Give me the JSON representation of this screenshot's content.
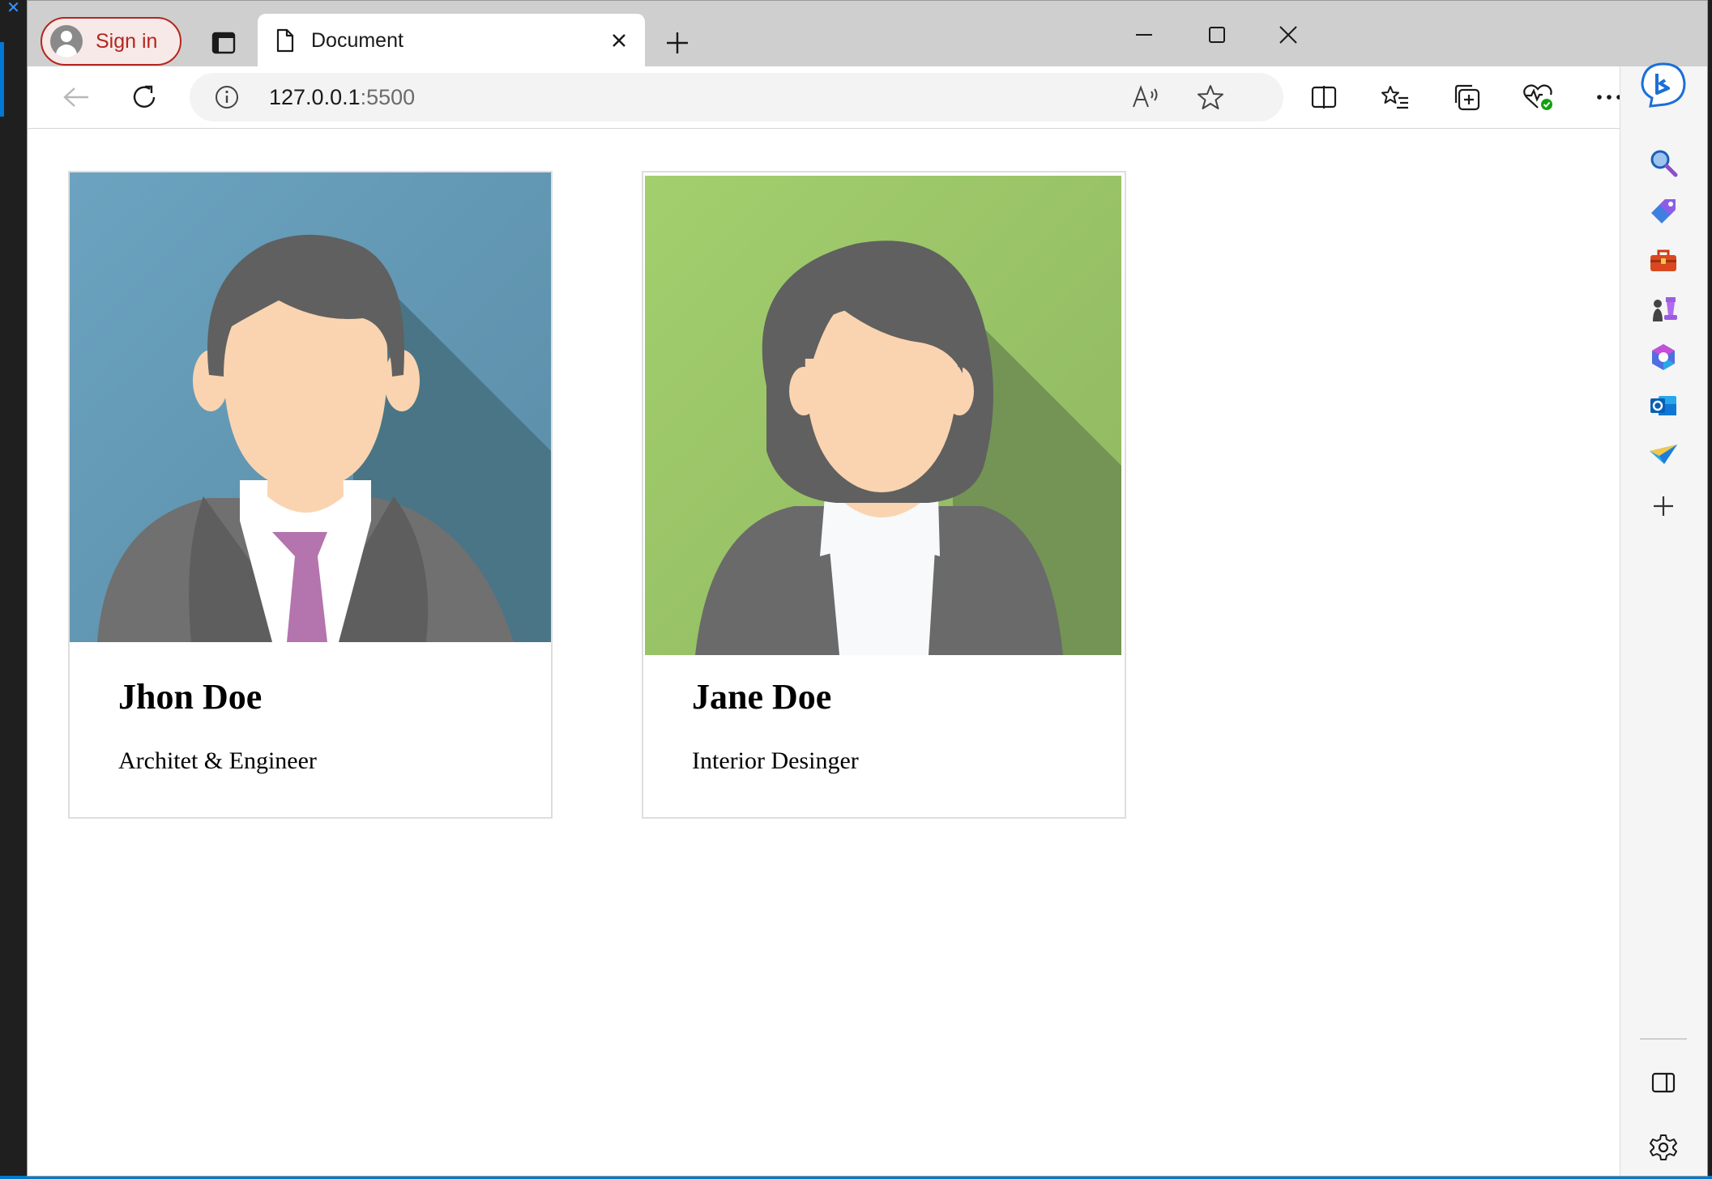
{
  "browser": {
    "profile_label": "Sign in",
    "tab_title": "Document",
    "url_host": "127.0.0.1",
    "url_port": ":5500"
  },
  "cards": [
    {
      "name": "Jhon Doe",
      "role": "Architet & Engineer",
      "bg": "#6a9ebd",
      "tie": "#b474ae"
    },
    {
      "name": "Jane Doe",
      "role": "Interior Desinger",
      "bg": "#9dc96b"
    }
  ],
  "colors": {
    "signin_accent": "#b3261e",
    "bing_accent": "#1b6fd8"
  },
  "sidebar_icons": [
    "search-icon",
    "shopping-tag-icon",
    "toolbox-icon",
    "games-icon",
    "office-icon",
    "outlook-icon",
    "send-icon",
    "add-icon",
    "panel-icon",
    "settings-icon"
  ]
}
